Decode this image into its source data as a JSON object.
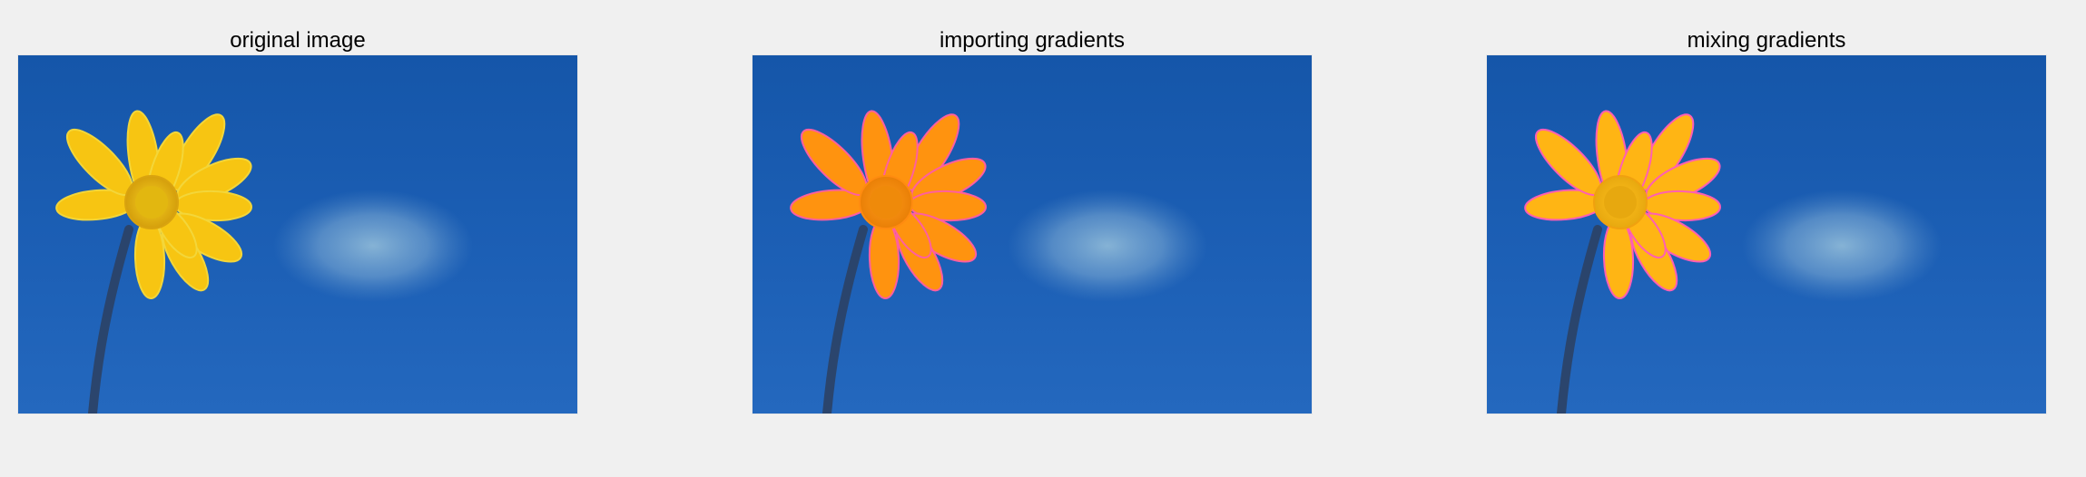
{
  "figure": {
    "panels": [
      {
        "title": "original image",
        "petal_color": "#f7c512",
        "center_color": "#ddb10d",
        "edge_color": "#f3d63a"
      },
      {
        "title": "importing gradients",
        "petal_color": "#ff930f",
        "center_color": "#ef8a0a",
        "edge_color": "#ff5f9f"
      },
      {
        "title": "mixing gradients",
        "petal_color": "#ffb514",
        "center_color": "#e7a80f",
        "edge_color": "#ff5fb3"
      }
    ]
  }
}
